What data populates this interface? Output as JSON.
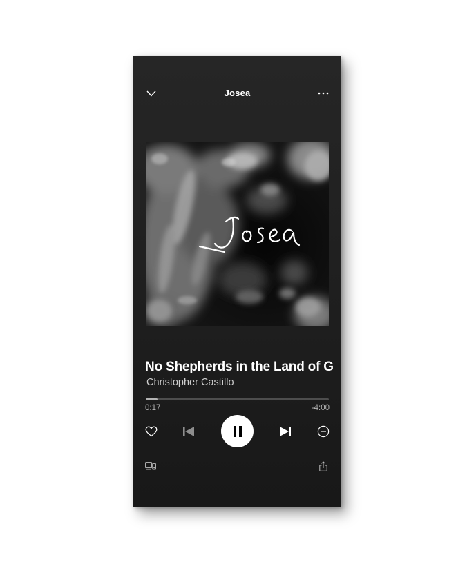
{
  "header": {
    "collapse_icon": "chevron-down-icon",
    "title": "Josea",
    "more_icon": "more-horizontal-icon"
  },
  "album_art": {
    "overlay_text": "Josea",
    "style": "black-and-white clouds"
  },
  "track": {
    "title": "No Shepherds in the Land of G",
    "artist": "Christopher Castillo"
  },
  "playback": {
    "elapsed": "0:17",
    "remaining": "-4:00",
    "progress_fraction": 0.066,
    "state": "playing"
  },
  "controls": {
    "like_icon": "heart-icon",
    "previous_icon": "skip-back-icon",
    "play_pause_icon": "pause-icon",
    "next_icon": "skip-forward-icon",
    "remove_icon": "minus-circle-icon"
  },
  "footer": {
    "devices_icon": "devices-icon",
    "share_icon": "share-icon"
  },
  "colors": {
    "background": "#212121",
    "text_primary": "#ffffff",
    "text_secondary": "#b3b3b3",
    "progress_track": "#4d4d4d",
    "play_button": "#ffffff"
  }
}
